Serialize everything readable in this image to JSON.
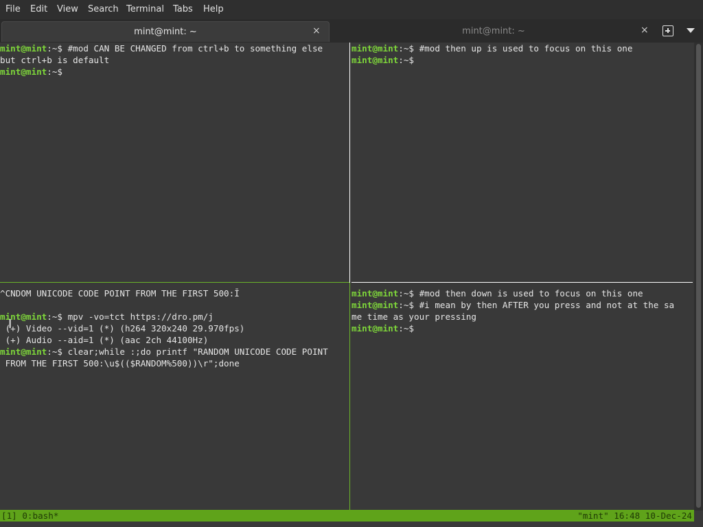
{
  "menu": {
    "items": [
      "File",
      "Edit",
      "View",
      "Search",
      "Terminal",
      "Tabs",
      "Help"
    ]
  },
  "tabs": [
    {
      "title": "mint@mint: ~",
      "close": "×"
    },
    {
      "title": "mint@mint: ~",
      "close": "×"
    }
  ],
  "panes": {
    "top_left": {
      "lines": [
        {
          "prompt": "mint@mint",
          "path": ":~$ ",
          "text": "#mod CAN BE CHANGED from ctrl+b to something else"
        },
        {
          "prompt": "",
          "path": "",
          "text": "but ctrl+b is default"
        },
        {
          "prompt": "mint@mint",
          "path": ":~$",
          "text": ""
        }
      ]
    },
    "top_right": {
      "lines": [
        {
          "prompt": "mint@mint",
          "path": ":~$ ",
          "text": "#mod then up is used to focus on this one"
        },
        {
          "prompt": "mint@mint",
          "path": ":~$",
          "text": ""
        }
      ]
    },
    "bottom_left": {
      "lines": [
        {
          "prompt": "",
          "path": "",
          "text": "^CNDOM UNICODE CODE POINT FROM THE FIRST 500:Ī"
        },
        {
          "prompt": "",
          "path": "",
          "text": ""
        },
        {
          "prompt": "mint@mint",
          "path": ":~$ ",
          "text": "mpv -vo=tct https://dro.pm/j"
        },
        {
          "prompt": "",
          "path": "",
          "text": " (+) Video --vid=1 (*) (h264 320x240 29.970fps)"
        },
        {
          "prompt": "",
          "path": "",
          "text": " (+) Audio --aid=1 (*) (aac 2ch 44100Hz)"
        },
        {
          "prompt": "mint@mint",
          "path": ":~$ ",
          "text": "clear;while :;do printf \"RANDOM UNICODE CODE POINT"
        },
        {
          "prompt": "",
          "path": "",
          "text": " FROM THE FIRST 500:\\u$(($RANDOM%500))\\r\";done"
        }
      ]
    },
    "bottom_right": {
      "lines": [
        {
          "prompt": "mint@mint",
          "path": ":~$ ",
          "text": "#mod then down is used to focus on this one"
        },
        {
          "prompt": "mint@mint",
          "path": ":~$ ",
          "text": "#i mean by then AFTER you press and not at the sa"
        },
        {
          "prompt": "",
          "path": "",
          "text": "me time as your pressing"
        },
        {
          "prompt": "mint@mint",
          "path": ":~$",
          "text": ""
        }
      ]
    }
  },
  "tmux_status": {
    "left": "[1] 0:bash*",
    "right": "\"mint\" 16:48 10-Dec-24"
  },
  "colors": {
    "background": "#393939",
    "prompt": "#7fd83a",
    "status_bar": "#5fa31a",
    "active_border": "#ffffff",
    "inactive_border": "#6bb52a"
  },
  "icons": [
    "new-tab-icon",
    "tab-menu-chevron-icon",
    "text-cursor-icon",
    "close-icon"
  ]
}
